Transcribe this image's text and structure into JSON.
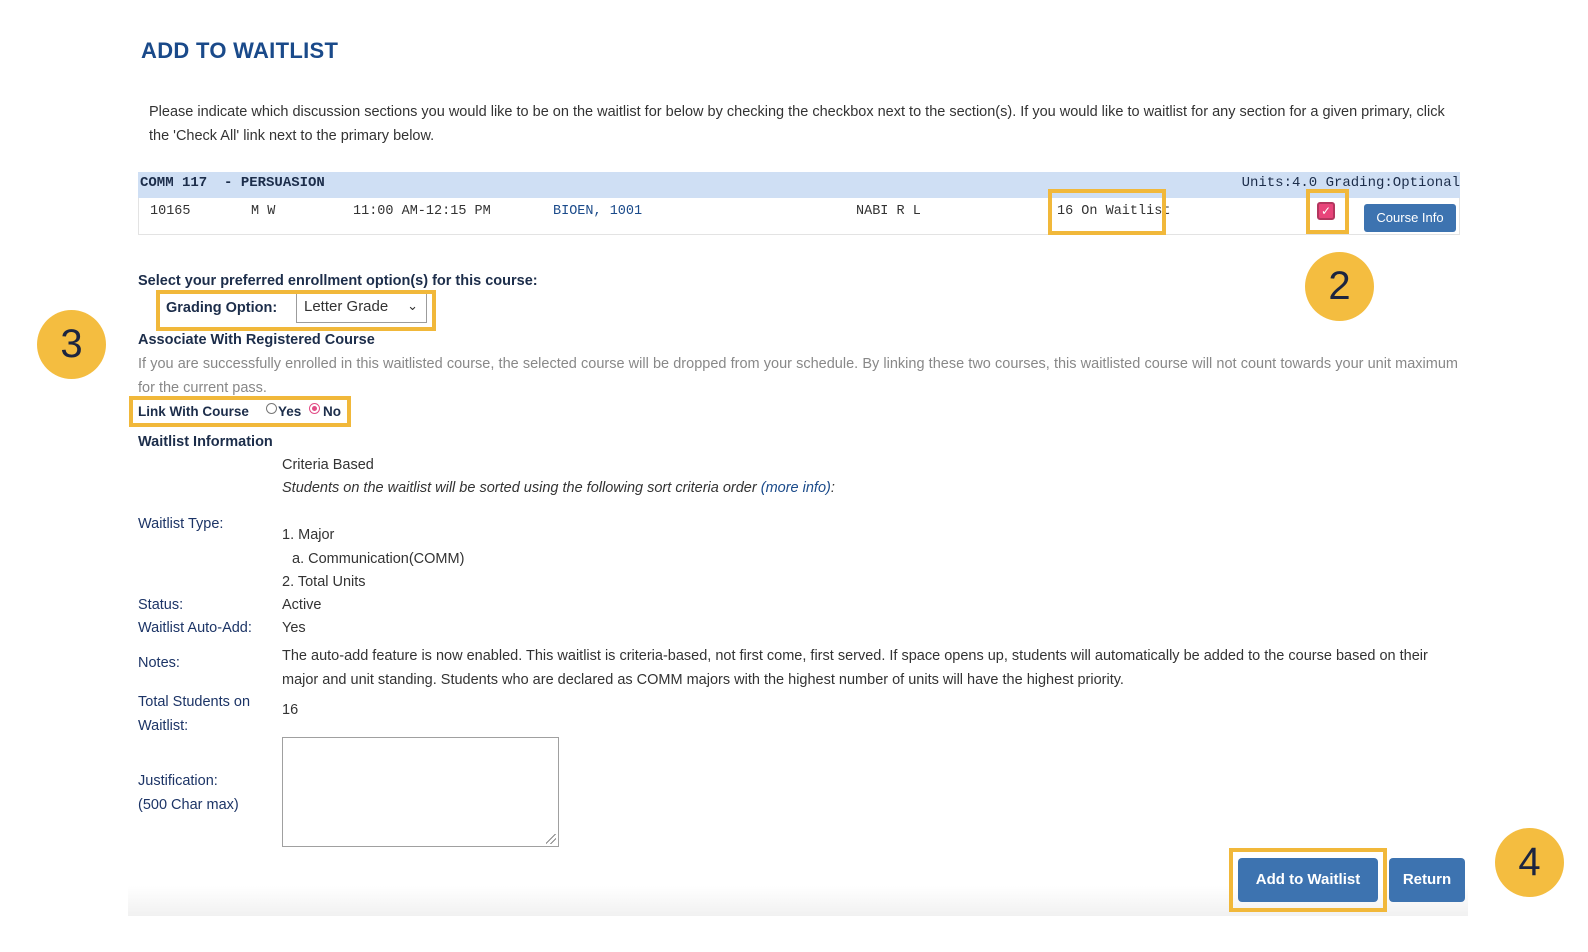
{
  "page": {
    "title": "ADD TO WAITLIST",
    "intro": "Please indicate which discussion sections you would like to be on the waitlist for below by checking the checkbox next to the section(s). If you would like to waitlist for any section for a given primary, click the 'Check All' link next to the primary below."
  },
  "course": {
    "title": "COMM 117  - PERSUASION",
    "units_grading": "Units:4.0 Grading:Optional",
    "section": {
      "id": "10165",
      "days": "M W",
      "time": "11:00 AM-12:15 PM",
      "location": "BIOEN, 1001",
      "instructor": "NABI R L",
      "waitlist": "16 On Waitlist",
      "checked": true,
      "course_info_label": "Course Info"
    }
  },
  "enrollment": {
    "heading": "Select your preferred enrollment option(s) for this course:",
    "grading_label": "Grading Option:",
    "grading_value": "Letter Grade",
    "associate_heading": "Associate With Registered Course",
    "associate_desc": "If you are successfully enrolled in this waitlisted course, the selected course will be dropped from your schedule. By linking these two courses, this waitlisted course will not count towards your unit maximum for the current pass.",
    "link_label": "Link With Course",
    "yes_label": "Yes",
    "no_label": "No",
    "selected": "No"
  },
  "waitlist_info": {
    "heading": "Waitlist Information",
    "type_label": "Waitlist Type:",
    "type_value": "Criteria Based",
    "sort_text": "Students on the waitlist will be sorted using the following sort criteria order ",
    "more_info": "(more info)",
    "colon": ":",
    "criteria_1": "1. Major",
    "criteria_1a": "a. Communication(COMM)",
    "criteria_2": "2. Total Units",
    "status_label": "Status:",
    "status_value": "Active",
    "auto_add_label": "Waitlist Auto-Add:",
    "auto_add_value": "Yes",
    "notes_label": "Notes:",
    "notes_value": "The auto-add feature is now enabled. This waitlist is criteria-based, not first come, first served. If space opens up, students will automatically be added to the course based on their major and unit standing. Students who are declared as COMM majors with the highest number of units will have the highest priority.",
    "total_label": "Total Students on Waitlist:",
    "total_value": "16",
    "justification_label": "Justification:",
    "justification_hint": "(500 Char max)",
    "justification_value": ""
  },
  "buttons": {
    "add": "Add to Waitlist",
    "return": "Return"
  },
  "annotations": {
    "step2": "2",
    "step3": "3",
    "step4": "4"
  },
  "colors": {
    "highlight": "#f1b83a",
    "step_circle": "#f4bd40",
    "button": "#3d73b0",
    "header_band": "#cfdff4",
    "title": "#1a4a8a"
  }
}
